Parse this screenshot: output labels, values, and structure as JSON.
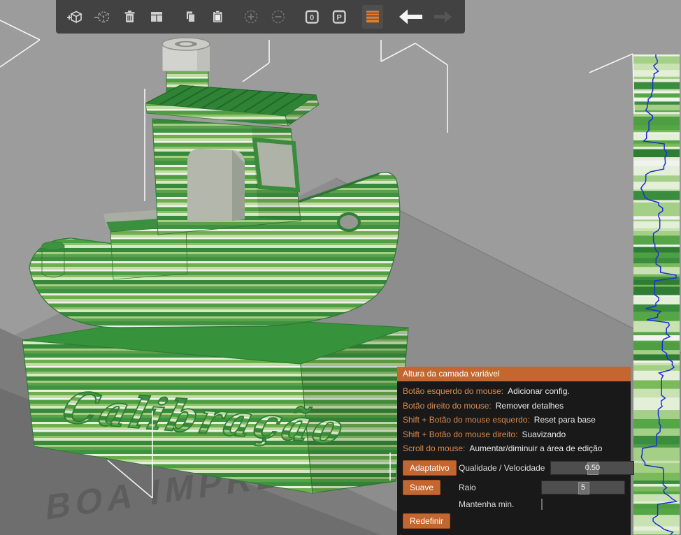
{
  "toolbar": {
    "icons": [
      {
        "name": "add-object",
        "enabled": true
      },
      {
        "name": "remove-object",
        "enabled": false
      },
      {
        "name": "delete-all",
        "enabled": true
      },
      {
        "name": "arrange",
        "enabled": true
      },
      {
        "name": "copy",
        "enabled": true
      },
      {
        "name": "paste",
        "enabled": true
      },
      {
        "name": "add-instance",
        "enabled": false
      },
      {
        "name": "remove-instance",
        "enabled": false
      },
      {
        "name": "split-to-objects",
        "enabled": true,
        "glyph": "0"
      },
      {
        "name": "split-to-parts",
        "enabled": true,
        "glyph": "P"
      },
      {
        "name": "variable-layer-height",
        "enabled": true,
        "active": true
      },
      {
        "name": "undo",
        "enabled": true
      },
      {
        "name": "redo",
        "enabled": false
      }
    ]
  },
  "panel": {
    "title": "Altura da camada variável",
    "shortcuts": [
      {
        "key": "Botão esquerdo do mouse:",
        "action": "Adicionar config."
      },
      {
        "key": "Botão direito do mouse:",
        "action": "Remover detalhes"
      },
      {
        "key": "Shift + Botão do mouse esquerdo:",
        "action": "Reset para base"
      },
      {
        "key": "Shift + Botão do mouse direito:",
        "action": "Suavizando"
      },
      {
        "key": "Scroll do mouse:",
        "action": "Aumentar/diminuir a área de edição"
      }
    ],
    "adaptive": {
      "button": "Adaptativo",
      "label": "Qualidade / Velocidade",
      "value": "0.50"
    },
    "smooth": {
      "button": "Suave",
      "label": "Raio",
      "value": "5"
    },
    "keep_min_label": "Mantenha min.",
    "keep_min_checked": false,
    "reset_button": "Redefinir"
  },
  "viewport": {
    "bed_text": "BOA IMPRESS",
    "model_text": "Calibração"
  },
  "layer_column": {
    "stripe_colors": [
      "#3a8d3c",
      "#55a646",
      "#7aba5b",
      "#a3cf86",
      "#c9e2b2",
      "#e4efd8",
      "#f1f3ee",
      "#2f7d33",
      "#4f9e44"
    ],
    "curve_color": "#1c2fd6"
  },
  "colors": {
    "accent_orange": "#c4662f",
    "key_text_orange": "#d98a4e",
    "active_tool_orange": "#e67a30",
    "toolbar_bg": "#3e3e3e",
    "panel_bg": "#191919",
    "viewport_bg": "#9c9c9c",
    "bed_mid": "#8f8f8f",
    "bed_shadow": "#6f6f6f",
    "model_green": "#36923b"
  }
}
